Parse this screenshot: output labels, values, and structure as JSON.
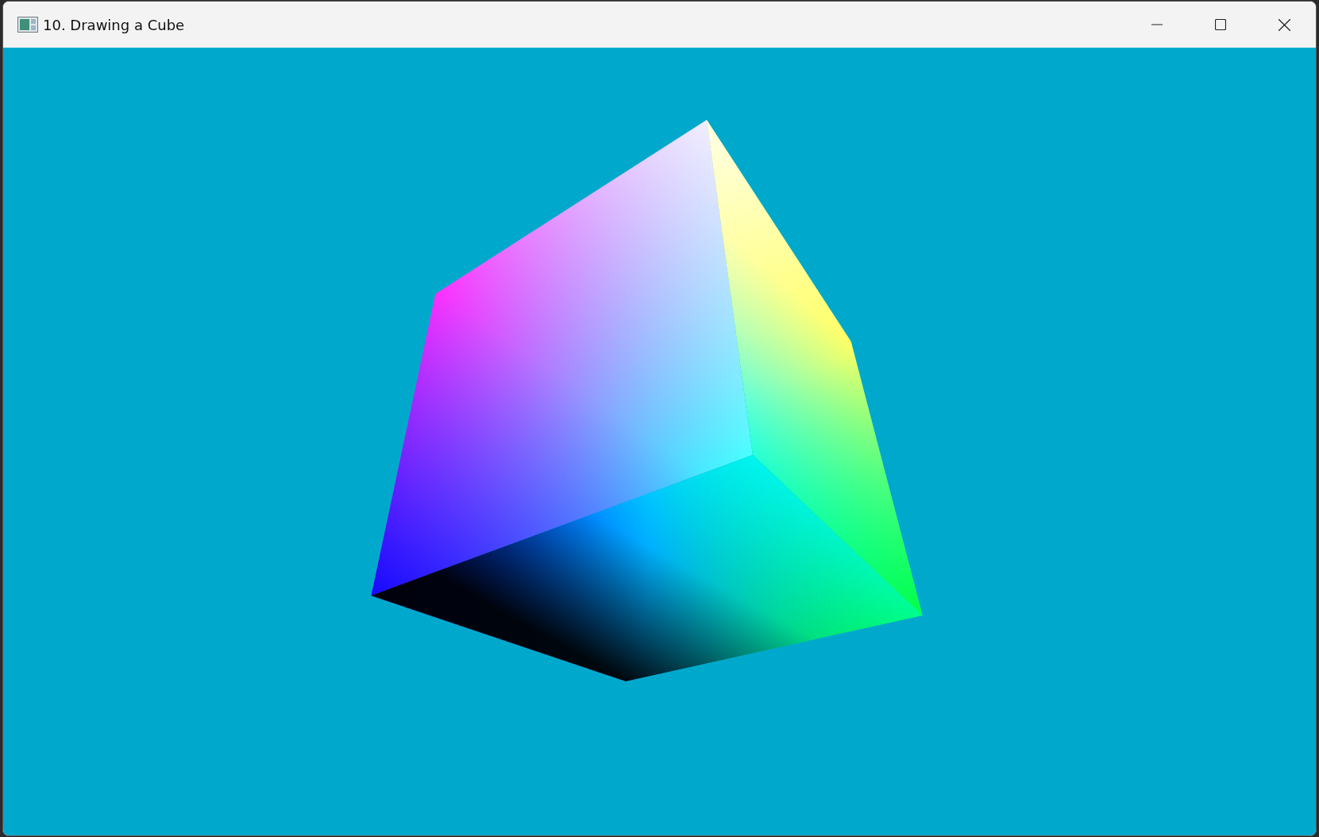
{
  "window": {
    "title": "10. Drawing a Cube"
  }
}
